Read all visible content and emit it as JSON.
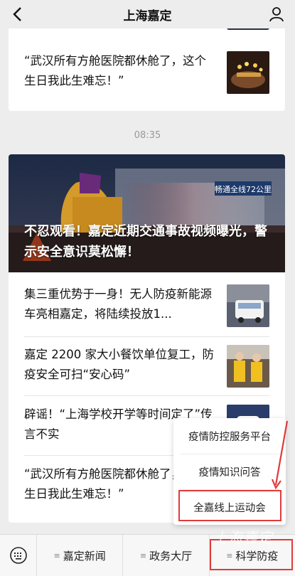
{
  "header": {
    "title": "上海嘉定"
  },
  "top_card": {
    "text": "“武汉所有方舱医院都休舱了，这个生日我此生难忘！”"
  },
  "timestamp": "08:35",
  "main_card": {
    "hero_caption": "不忍观看！嘉定近期交通事故视频曝光，警示安全意识莫松懈！",
    "hero_sign_text": "畅通全线72公里",
    "articles": [
      {
        "text": "集三重优势于一身！无人防疫新能源车亮相嘉定，将陆续投放1..."
      },
      {
        "text": "嘉定 2200 家大小餐饮单位复工，防疫安全可扫“安心码”"
      },
      {
        "text": "辟谣！“上海学校开学等时间定了”传言不实"
      },
      {
        "text": "“武汉所有方舱医院都休舱了，这个生日我此生难忘！”"
      }
    ]
  },
  "popup_menu": {
    "items": [
      "疫情防控服务平台",
      "疫情知识问答",
      "全嘉线上运动会"
    ]
  },
  "tabbar": {
    "tabs": [
      "嘉定新闻",
      "政务大厅",
      "科学防疫"
    ]
  },
  "watermark": "上海嘉定",
  "colors": {
    "highlight": "#e03b3b",
    "background": "#ededed"
  }
}
